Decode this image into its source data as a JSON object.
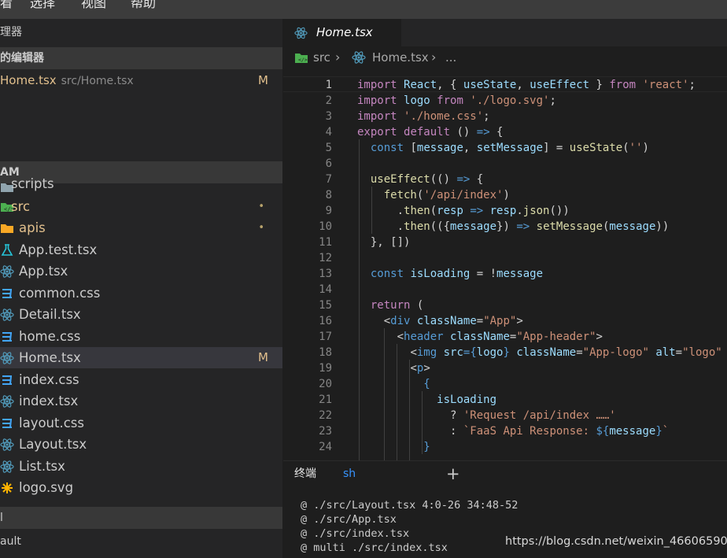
{
  "menubar": {
    "items": [
      "看",
      "选择",
      "视图",
      "帮助"
    ]
  },
  "sidebar": {
    "title": "理器",
    "open_editors_label": "的编辑器",
    "open_editor": {
      "name": "Home.tsx",
      "path": "src/Home.tsx",
      "status": "M"
    },
    "section_label": "AM",
    "tree": [
      {
        "label": "scripts",
        "icon": "folder-icon"
      },
      {
        "label": "src",
        "icon": "folder-src-icon",
        "dot": "•"
      },
      {
        "label": "apis",
        "icon": "folder-icon",
        "dot": "•"
      },
      {
        "label": "App.test.tsx",
        "icon": "test-flask-icon"
      },
      {
        "label": "App.tsx",
        "icon": "react-icon"
      },
      {
        "label": "common.css",
        "icon": "css-icon"
      },
      {
        "label": "Detail.tsx",
        "icon": "react-icon"
      },
      {
        "label": "home.css",
        "icon": "css-icon"
      },
      {
        "label": "Home.tsx",
        "icon": "react-icon",
        "status": "M",
        "selected": true
      },
      {
        "label": "index.css",
        "icon": "css-icon"
      },
      {
        "label": "index.tsx",
        "icon": "react-icon"
      },
      {
        "label": "layout.css",
        "icon": "css-icon"
      },
      {
        "label": "Layout.tsx",
        "icon": "react-icon"
      },
      {
        "label": "List.tsx",
        "icon": "react-icon"
      },
      {
        "label": "logo.svg",
        "icon": "svg-asterisk-icon"
      }
    ],
    "bottom_section_label": "l",
    "bottom_item": "ault"
  },
  "tab": {
    "label": "Home.tsx",
    "icon": "react-icon"
  },
  "breadcrumb": {
    "folder": "src",
    "file": "Home.tsx",
    "more": "..."
  },
  "editor": {
    "active_line": 1,
    "lines": [
      {
        "n": "1"
      },
      {
        "n": "2"
      },
      {
        "n": "3"
      },
      {
        "n": "4"
      },
      {
        "n": "5"
      },
      {
        "n": "6"
      },
      {
        "n": "7"
      },
      {
        "n": "8"
      },
      {
        "n": "9"
      },
      {
        "n": "10"
      },
      {
        "n": "11"
      },
      {
        "n": "12"
      },
      {
        "n": "13"
      },
      {
        "n": "14"
      },
      {
        "n": "15"
      },
      {
        "n": "16"
      },
      {
        "n": "17"
      },
      {
        "n": "18"
      },
      {
        "n": "19"
      },
      {
        "n": "20"
      },
      {
        "n": "21"
      },
      {
        "n": "22"
      },
      {
        "n": "23"
      },
      {
        "n": "24"
      }
    ],
    "code": {
      "l1": [
        "import",
        "React",
        ", { ",
        "useState",
        ", ",
        "useEffect",
        " } ",
        "from",
        " ",
        "'react'",
        ";"
      ],
      "l2": [
        "import",
        "logo",
        "from",
        "'./logo.svg'",
        ";"
      ],
      "l3": [
        "import",
        "'./home.css'",
        ";"
      ],
      "l4": [
        "export",
        "default",
        "() ",
        "=>",
        " {"
      ],
      "l5": [
        "const",
        "[",
        "message",
        ", ",
        "setMessage",
        "] = ",
        "useState",
        "(",
        "''",
        ")"
      ],
      "l7": [
        "useEffect",
        "(",
        "() ",
        "=>",
        " {"
      ],
      "l8": [
        "fetch",
        "(",
        "'/api/index'",
        ")"
      ],
      "l9": [
        ".",
        "then",
        "(",
        "resp",
        " => ",
        "resp",
        ".",
        "json",
        "())"
      ],
      "l10": [
        ".",
        "then",
        "(({",
        "message",
        "}) ",
        "=>",
        " ",
        "setMessage",
        "(",
        "message",
        "))"
      ],
      "l11": [
        "}, [])"
      ],
      "l13": [
        "const",
        "isLoading",
        " = !",
        "message"
      ],
      "l15": [
        "return",
        " ("
      ],
      "l16": [
        "<",
        "div",
        " ",
        "className",
        "=",
        "\"App\"",
        ">"
      ],
      "l17": [
        "<",
        "header",
        " ",
        "className",
        "=",
        "\"App-header\"",
        ">"
      ],
      "l18": [
        "<",
        "img",
        " ",
        "src",
        "={",
        "logo",
        "} ",
        "className",
        "=",
        "\"App-logo\"",
        " ",
        "alt",
        "=",
        "\"logo\"",
        " /"
      ],
      "l19": [
        "<",
        "p",
        ">"
      ],
      "l20": [
        "{"
      ],
      "l21": [
        "isLoading"
      ],
      "l22": [
        "? ",
        "'Request /api/index ……'"
      ],
      "l23": [
        ": ",
        "`FaaS Api Response: ",
        "${",
        "message",
        "}",
        "`"
      ],
      "l24": [
        "}"
      ]
    }
  },
  "panel": {
    "terminal_tab": "终端",
    "shell_tab": "sh",
    "add_label": "+"
  },
  "terminal": {
    "lines": [
      "@ ./src/Layout.tsx 4:0-26 34:48-52",
      "@ ./src/App.tsx",
      "@ ./src/index.tsx",
      "@ multi ./src/index.tsx"
    ]
  },
  "watermark": "https://blog.csdn.net/weixin_46606590",
  "colors": {
    "keyword": "#569cd6",
    "control": "#c586c0",
    "variable": "#9cdcfe",
    "function": "#dcdcaa",
    "string": "#ce9178",
    "modified": "#e2c08d",
    "react": "#519aba",
    "css": "#42a5f5"
  }
}
